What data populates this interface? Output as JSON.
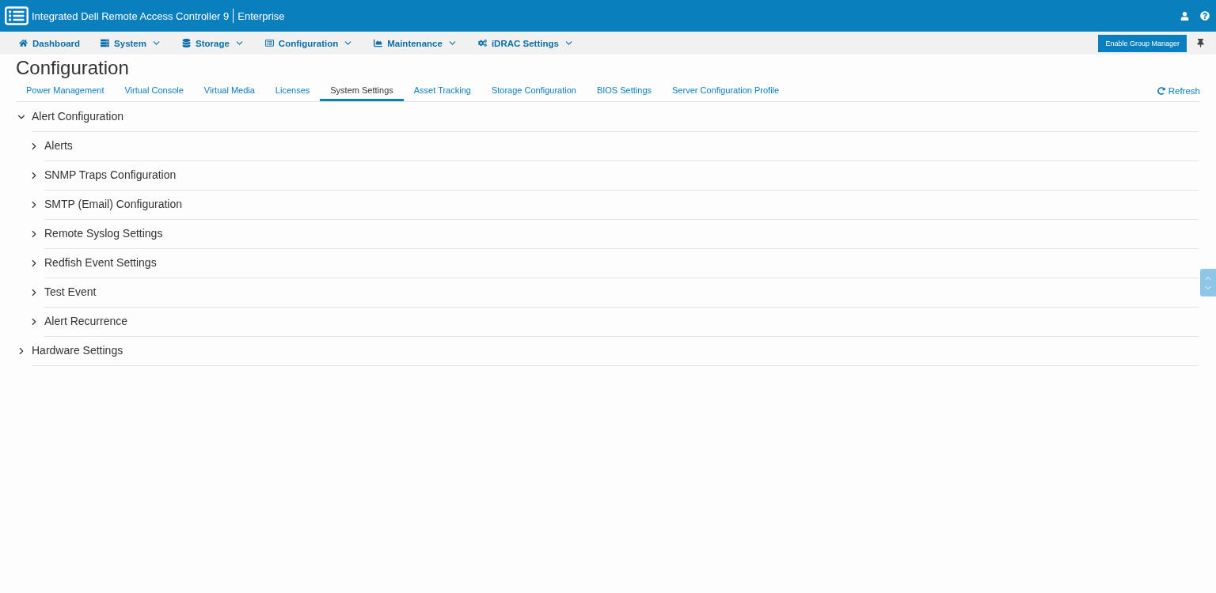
{
  "header": {
    "title": "Integrated Dell Remote Access Controller 9",
    "edition": "Enterprise"
  },
  "nav": [
    {
      "label": "Dashboard",
      "dropdown": false
    },
    {
      "label": "System",
      "dropdown": true
    },
    {
      "label": "Storage",
      "dropdown": true
    },
    {
      "label": "Configuration",
      "dropdown": true
    },
    {
      "label": "Maintenance",
      "dropdown": true
    },
    {
      "label": "iDRAC Settings",
      "dropdown": true
    }
  ],
  "group_manager_button": "Enable Group Manager",
  "page_title": "Configuration",
  "tabs": [
    {
      "label": "Power Management",
      "selected": false
    },
    {
      "label": "Virtual Console",
      "selected": false
    },
    {
      "label": "Virtual Media",
      "selected": false
    },
    {
      "label": "Licenses",
      "selected": false
    },
    {
      "label": "System Settings",
      "selected": true
    },
    {
      "label": "Asset Tracking",
      "selected": false
    },
    {
      "label": "Storage Configuration",
      "selected": false
    },
    {
      "label": "BIOS Settings",
      "selected": false
    },
    {
      "label": "Server Configuration Profile",
      "selected": false
    }
  ],
  "refresh": "Refresh",
  "sections": [
    {
      "label": "Alert Configuration",
      "expanded": true,
      "children": [
        {
          "label": "Alerts",
          "expanded": false
        },
        {
          "label": "SNMP Traps Configuration",
          "expanded": false
        },
        {
          "label": "SMTP (Email) Configuration",
          "expanded": false
        },
        {
          "label": "Remote Syslog Settings",
          "expanded": false
        },
        {
          "label": "Redfish Event Settings",
          "expanded": false
        },
        {
          "label": "Test Event",
          "expanded": false
        },
        {
          "label": "Alert Recurrence",
          "expanded": false
        }
      ]
    },
    {
      "label": "Hardware Settings",
      "expanded": false
    }
  ]
}
